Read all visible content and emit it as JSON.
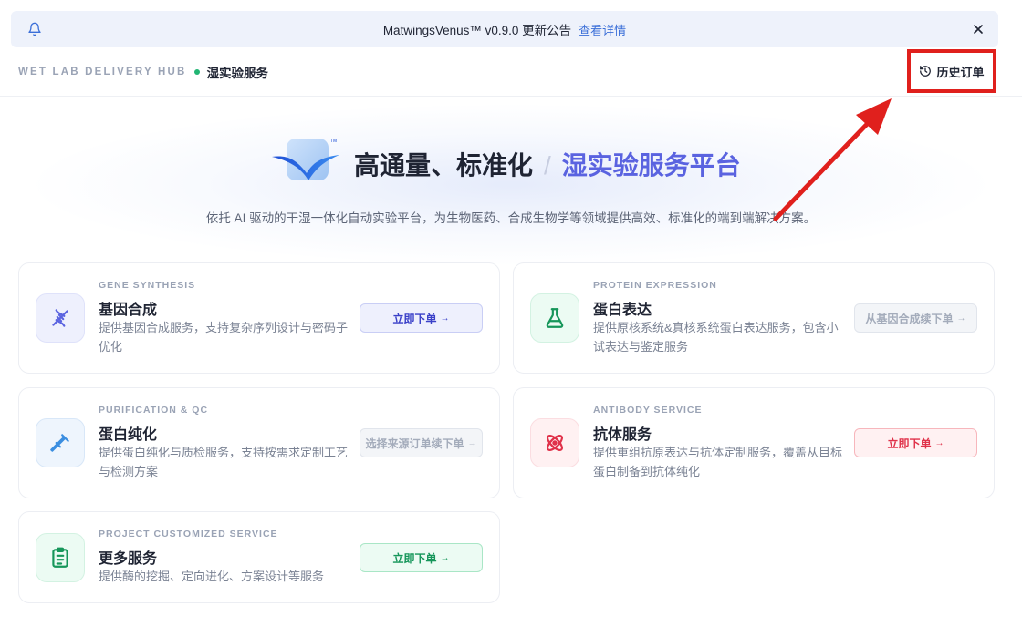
{
  "banner": {
    "message": "MatwingsVenus™ v0.9.0 更新公告",
    "link": "查看详情"
  },
  "header": {
    "hub": "WET LAB DELIVERY HUB",
    "current": "湿实验服务",
    "history_label": "历史订单"
  },
  "hero": {
    "title_main": "高通量、标准化",
    "title_sep": "/",
    "title_accent": "湿实验服务平台",
    "subtitle": "依托 AI 驱动的干湿一体化自动实验平台，为生物医药、合成生物学等领域提供高效、标准化的端到端解决方案。"
  },
  "cards": [
    {
      "en": "GENE SYNTHESIS",
      "zh": "基因合成",
      "desc": "提供基因合成服务，支持复杂序列设计与密码子优化",
      "button": "立即下单",
      "icon": "dna-icon",
      "color": "#5a63e0"
    },
    {
      "en": "PROTEIN EXPRESSION",
      "zh": "蛋白表达",
      "desc": "提供原核系统&真核系统蛋白表达服务，包含小试表达与鉴定服务",
      "button": "从基因合成续下单",
      "icon": "flask-icon",
      "color": "#16965a"
    },
    {
      "en": "PURIFICATION & QC",
      "zh": "蛋白纯化",
      "desc": "提供蛋白纯化与质检服务，支持按需求定制工艺与检测方案",
      "button": "选择来源订单续下单",
      "icon": "pipette-icon",
      "color": "#3b8ee0"
    },
    {
      "en": "ANTIBODY SERVICE",
      "zh": "抗体服务",
      "desc": "提供重组抗原表达与抗体定制服务，覆盖从目标蛋白制备到抗体纯化",
      "button": "立即下单",
      "icon": "atom-icon",
      "color": "#e0324a"
    },
    {
      "en": "PROJECT CUSTOMIZED SERVICE",
      "zh": "更多服务",
      "desc": "提供酶的挖掘、定向进化、方案设计等服务",
      "button": "立即下单",
      "icon": "clipboard-icon",
      "color": "#16965a"
    }
  ]
}
